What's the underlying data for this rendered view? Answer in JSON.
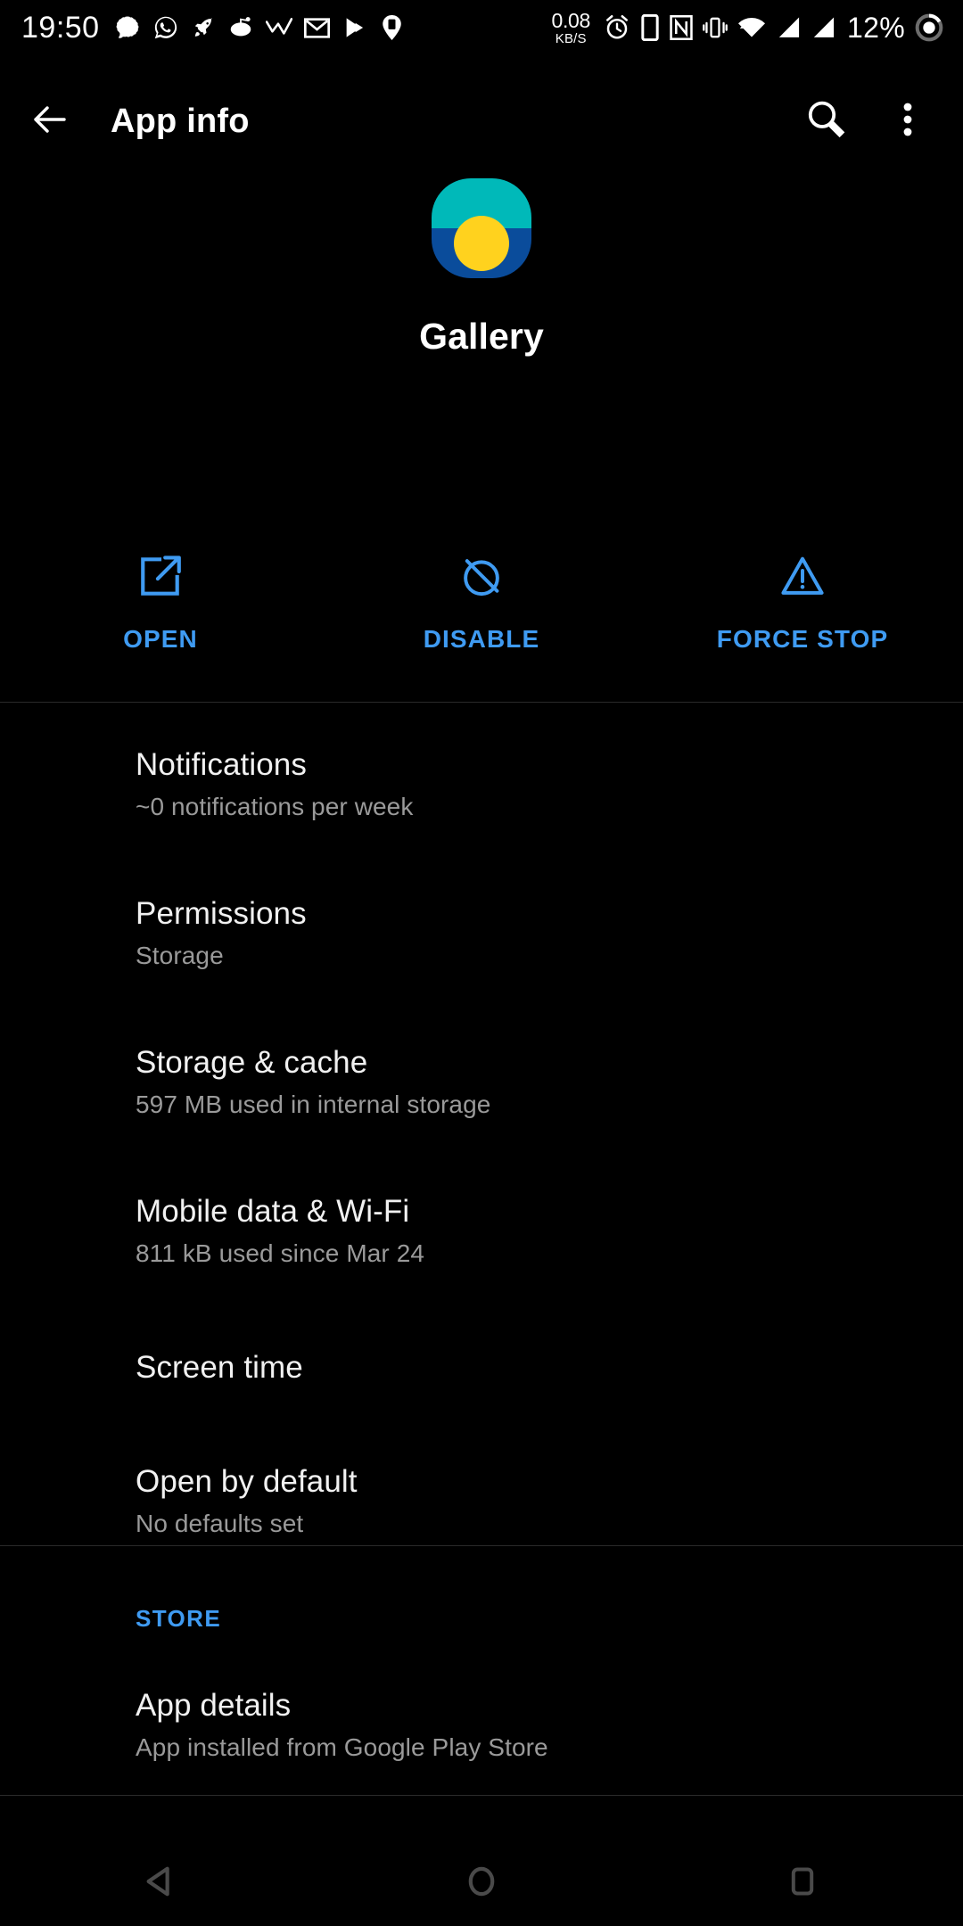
{
  "theme": {
    "background": "#000000",
    "accent_blue": "#3F9BF2",
    "primary_text": "#f1f1f1",
    "secondary_text": "#9a9a9a",
    "divider": "#2a2a2a",
    "nav_icon": "#4a4a4a"
  },
  "status_bar": {
    "time": "19:50",
    "network_speed_value": "0.08",
    "network_speed_unit": "KB/S",
    "battery_percent": "12%",
    "left_icons": [
      "signal-messenger-icon",
      "whatsapp-icon",
      "rocket-icon",
      "reddit-icon",
      "chart-line-icon",
      "gmail-icon",
      "play-store-icon",
      "device-pin-icon"
    ],
    "right_icons": [
      "alarm-icon",
      "phone-icon",
      "nfc-icon",
      "vibrate-icon",
      "wifi-icon",
      "cell-signal-1-icon",
      "cell-signal-2-icon",
      "battery-circle-icon"
    ]
  },
  "toolbar": {
    "back_label": "Back",
    "title": "App info",
    "search_label": "Search",
    "overflow_label": "More options"
  },
  "app": {
    "name": "Gallery",
    "icon": {
      "name": "gallery-app-icon",
      "top_color": "#00B9B9",
      "bottom_color": "#0A4C9B",
      "sun_color": "#FFD21E"
    }
  },
  "actions": [
    {
      "id": "open",
      "label": "OPEN",
      "icon": "open-external-icon"
    },
    {
      "id": "disable",
      "label": "DISABLE",
      "icon": "block-circle-icon"
    },
    {
      "id": "force-stop",
      "label": "FORCE STOP",
      "icon": "warning-triangle-icon"
    }
  ],
  "settings_items": [
    {
      "id": "notifications",
      "title": "Notifications",
      "subtitle": "~0 notifications per week"
    },
    {
      "id": "permissions",
      "title": "Permissions",
      "subtitle": "Storage"
    },
    {
      "id": "storage-cache",
      "title": "Storage & cache",
      "subtitle": "597 MB used in internal storage"
    },
    {
      "id": "mobile-data-wifi",
      "title": "Mobile data & Wi-Fi",
      "subtitle": "811 kB used since Mar 24"
    },
    {
      "id": "screen-time",
      "title": "Screen time",
      "subtitle": ""
    },
    {
      "id": "open-by-default",
      "title": "Open by default",
      "subtitle": "No defaults set"
    }
  ],
  "store_section": {
    "header": "STORE",
    "items": [
      {
        "id": "app-details",
        "title": "App details",
        "subtitle": "App installed from Google Play Store"
      }
    ]
  },
  "nav_bar": {
    "back_label": "Back",
    "home_label": "Home",
    "recents_label": "Recents"
  }
}
